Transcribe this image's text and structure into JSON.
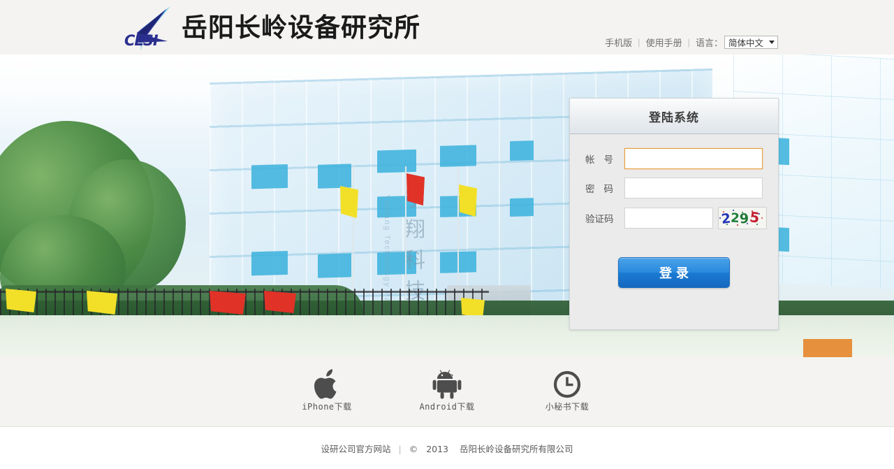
{
  "header": {
    "logo_text": "CLSI",
    "logo_icon": "arrow-swoosh-logo",
    "title": "岳阳长岭设备研究所",
    "nav": {
      "mobile": "手机版",
      "manual": "使用手册",
      "separator": "|",
      "language_label": "语言：",
      "language_value": "简体中文",
      "language_options": [
        "简体中文"
      ]
    }
  },
  "banner": {
    "alt": "岳阳长岭设备研究所办公大楼",
    "building_sign_cn": "宇翔科技园",
    "building_sign_en": "Yuxiang Technology Park"
  },
  "login": {
    "title": "登陆系统",
    "username": {
      "label": "帐号",
      "label_char1": "帐",
      "label_char2": "号",
      "value": "",
      "placeholder": "",
      "focused": true
    },
    "password": {
      "label": "密码",
      "label_char1": "密",
      "label_char2": "码",
      "value": "",
      "placeholder": ""
    },
    "captcha": {
      "label": "验证码",
      "value": "",
      "placeholder": "",
      "image_text": "2295",
      "image_digits": [
        {
          "char": "2",
          "color": "#2436b8"
        },
        {
          "char": "2",
          "color": "#1d7f3a"
        },
        {
          "char": "9",
          "color": "#1e7a35"
        },
        {
          "char": "5",
          "color": "#c31f2e"
        }
      ]
    },
    "submit_label": "登录",
    "accent_focus_color": "#e79b36",
    "button_color": "#1a7ad2"
  },
  "downloads": [
    {
      "icon": "apple-icon",
      "label": "iPhone下载"
    },
    {
      "icon": "android-icon",
      "label": "Android下载"
    },
    {
      "icon": "clock-icon",
      "label": "小秘书下载"
    }
  ],
  "footer": {
    "site_link": "设研公司官方网站",
    "separator": "|",
    "copyright_symbol": "©",
    "year": "2013",
    "company": "岳阳长岭设备研究所有限公司"
  }
}
